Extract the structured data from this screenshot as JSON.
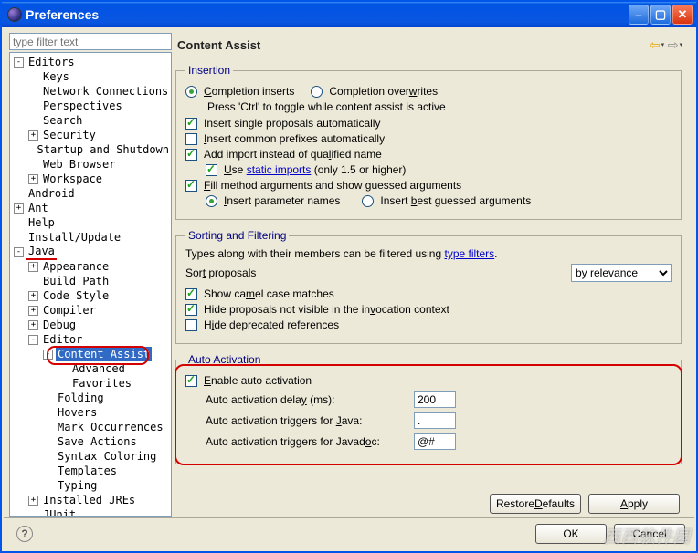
{
  "window": {
    "title": "Preferences"
  },
  "filter": {
    "placeholder": "type filter text"
  },
  "tree": [
    {
      "depth": 0,
      "twisty": "-",
      "label": "Editors"
    },
    {
      "depth": 1,
      "twisty": "",
      "label": "Keys"
    },
    {
      "depth": 1,
      "twisty": "",
      "label": "Network Connections"
    },
    {
      "depth": 1,
      "twisty": "",
      "label": "Perspectives"
    },
    {
      "depth": 1,
      "twisty": "",
      "label": "Search"
    },
    {
      "depth": 1,
      "twisty": "+",
      "label": "Security"
    },
    {
      "depth": 1,
      "twisty": "",
      "label": "Startup and Shutdown"
    },
    {
      "depth": 1,
      "twisty": "",
      "label": "Web Browser"
    },
    {
      "depth": 1,
      "twisty": "+",
      "label": "Workspace"
    },
    {
      "depth": 0,
      "twisty": "",
      "label": "Android"
    },
    {
      "depth": 0,
      "twisty": "+",
      "label": "Ant"
    },
    {
      "depth": 0,
      "twisty": "",
      "label": "Help"
    },
    {
      "depth": 0,
      "twisty": "",
      "label": "Install/Update"
    },
    {
      "depth": 0,
      "twisty": "-",
      "label": "Java",
      "underline": "red"
    },
    {
      "depth": 1,
      "twisty": "+",
      "label": "Appearance"
    },
    {
      "depth": 1,
      "twisty": "",
      "label": "Build Path"
    },
    {
      "depth": 1,
      "twisty": "+",
      "label": "Code Style"
    },
    {
      "depth": 1,
      "twisty": "+",
      "label": "Compiler"
    },
    {
      "depth": 1,
      "twisty": "+",
      "label": "Debug"
    },
    {
      "depth": 1,
      "twisty": "-",
      "label": "Editor"
    },
    {
      "depth": 2,
      "twisty": "-",
      "label": "Content Assist",
      "selected": true,
      "redbox": true
    },
    {
      "depth": 3,
      "twisty": "",
      "label": "Advanced"
    },
    {
      "depth": 3,
      "twisty": "",
      "label": "Favorites"
    },
    {
      "depth": 2,
      "twisty": "",
      "label": "Folding"
    },
    {
      "depth": 2,
      "twisty": "",
      "label": "Hovers"
    },
    {
      "depth": 2,
      "twisty": "",
      "label": "Mark Occurrences"
    },
    {
      "depth": 2,
      "twisty": "",
      "label": "Save Actions"
    },
    {
      "depth": 2,
      "twisty": "",
      "label": "Syntax Coloring"
    },
    {
      "depth": 2,
      "twisty": "",
      "label": "Templates"
    },
    {
      "depth": 2,
      "twisty": "",
      "label": "Typing"
    },
    {
      "depth": 1,
      "twisty": "+",
      "label": "Installed JREs"
    },
    {
      "depth": 1,
      "twisty": "",
      "label": "JUnit"
    }
  ],
  "page": {
    "title": "Content Assist",
    "insertion": {
      "legend": "Insertion",
      "radios": {
        "completion_inserts": {
          "label": "Completion inserts",
          "mnemonic": "C",
          "checked": true
        },
        "completion_overwrites": {
          "label": "Completion overwrites",
          "mnemonic": "w",
          "checked": false
        }
      },
      "toggle_hint": "Press 'Ctrl' to toggle while content assist is active",
      "insert_single": {
        "label": "Insert single proposals automatically",
        "checked": true
      },
      "insert_common": {
        "label": "Insert common prefixes automatically",
        "checked": false
      },
      "add_import": {
        "label": "Add import instead of qualified name",
        "checked": true
      },
      "use_static": {
        "prefix": "Use ",
        "link": "static imports",
        "suffix": " (only 1.5 or higher)",
        "checked": true
      },
      "fill_args": {
        "label": "Fill method arguments and show guessed arguments",
        "checked": true
      },
      "fill_radios": {
        "insert_param_names": {
          "label": "Insert parameter names",
          "checked": true
        },
        "insert_best_guessed": {
          "label": "Insert best guessed arguments",
          "checked": false
        }
      }
    },
    "sorting": {
      "legend": "Sorting and Filtering",
      "filter_hint_prefix": "Types along with their members can be filtered using ",
      "filter_hint_link": "type filters",
      "filter_hint_suffix": ".",
      "sort_label": "Sort proposals",
      "sort_value": "by relevance",
      "show_camel": {
        "label": "Show camel case matches",
        "checked": true
      },
      "hide_notvis": {
        "label": "Hide proposals not visible in the invocation context",
        "checked": true
      },
      "hide_depr": {
        "label": "Hide deprecated references",
        "checked": false
      }
    },
    "auto": {
      "legend": "Auto Activation",
      "enable": {
        "label": "Enable auto activation",
        "checked": true
      },
      "delay": {
        "label": "Auto activation delay (ms):",
        "value": "200"
      },
      "trig_java": {
        "label": "Auto activation triggers for Java:",
        "value": "."
      },
      "trig_jdoc": {
        "label": "Auto activation triggers for Javadoc:",
        "value": "@#"
      }
    }
  },
  "buttons": {
    "restore": "Restore Defaults",
    "apply": "Apply",
    "ok": "OK",
    "cancel": "Cancel"
  },
  "watermark": "西西软件园"
}
